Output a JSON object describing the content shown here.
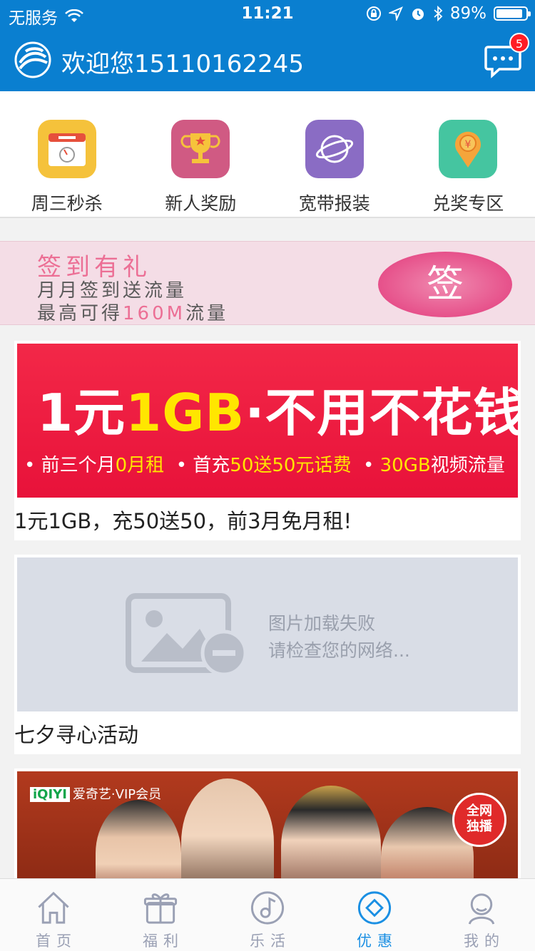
{
  "status_bar": {
    "carrier": "无服务",
    "time": "11:21",
    "battery": "89%",
    "battery_level": 0.89
  },
  "header": {
    "welcome": "欢迎您15110162245",
    "message_badge": "5"
  },
  "quick_menu": [
    {
      "label": "周三秒杀",
      "icon": "calendar-timer-icon",
      "color": "#f5c23b"
    },
    {
      "label": "新人奖励",
      "icon": "trophy-icon",
      "color": "#d05a83"
    },
    {
      "label": "宽带报装",
      "icon": "planet-icon",
      "color": "#8a6cc4"
    },
    {
      "label": "兑奖专区",
      "icon": "location-coin-icon",
      "color": "#45c5a0"
    }
  ],
  "sign_banner": {
    "title": "签到有礼",
    "line1": "月月签到送流量",
    "line2_prefix": "最高可得",
    "line2_highlight": "160M",
    "line2_suffix": "流量",
    "button": "签"
  },
  "cards": [
    {
      "title": "1元1GB，充50送50，前3月免月租!",
      "banner": {
        "big_prefix": "1元",
        "big_highlight": "1GB",
        "big_suffix": "·不用不花钱",
        "sub_1a": "• 前三个月",
        "sub_1b": "0月租",
        "sub_2a": "• 首充",
        "sub_2b": "50送50元话费",
        "sub_3a": "• ",
        "sub_3b": "30GB",
        "sub_3c": "视频流量"
      }
    },
    {
      "title": "七夕寻心活动",
      "fail_line1": "图片加载失败",
      "fail_line2": "请检查您的网络..."
    },
    {
      "brand": "爱奇艺·VIP会员",
      "brand_logo": "iQIYI",
      "badge_line1": "全网",
      "badge_line2": "独播"
    }
  ],
  "tabs": [
    {
      "label": "首页",
      "icon": "home-icon",
      "active": false
    },
    {
      "label": "福利",
      "icon": "gift-icon",
      "active": false
    },
    {
      "label": "乐活",
      "icon": "music-icon",
      "active": false
    },
    {
      "label": "优惠",
      "icon": "diamond-icon",
      "active": true
    },
    {
      "label": "我的",
      "icon": "user-icon",
      "active": false
    }
  ],
  "colors": {
    "brand_blue": "#0a7fd0",
    "active_tab": "#1a8fe3",
    "inactive_tab": "#9aa0b4",
    "promo_red": "#f32848"
  }
}
